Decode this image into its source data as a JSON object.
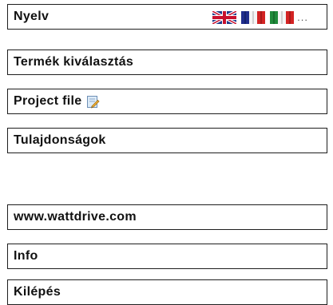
{
  "language_menu": {
    "label": "Nyelv",
    "flags": [
      "uk-flag-icon",
      "france-flag-icon",
      "italy-flag-icon"
    ],
    "more_label": "..."
  },
  "menu_items": [
    {
      "label": "Termék kiválasztás"
    },
    {
      "label": "Project file",
      "icon": "edit-document-icon"
    },
    {
      "label": "Tulajdonságok"
    }
  ],
  "secondary_items": [
    {
      "label": "www.wattdrive.com"
    },
    {
      "label": "Info"
    },
    {
      "label": "Kilépés"
    }
  ],
  "colors": {
    "border": "#1e1e1e",
    "text": "#111111",
    "background": "#ffffff"
  }
}
